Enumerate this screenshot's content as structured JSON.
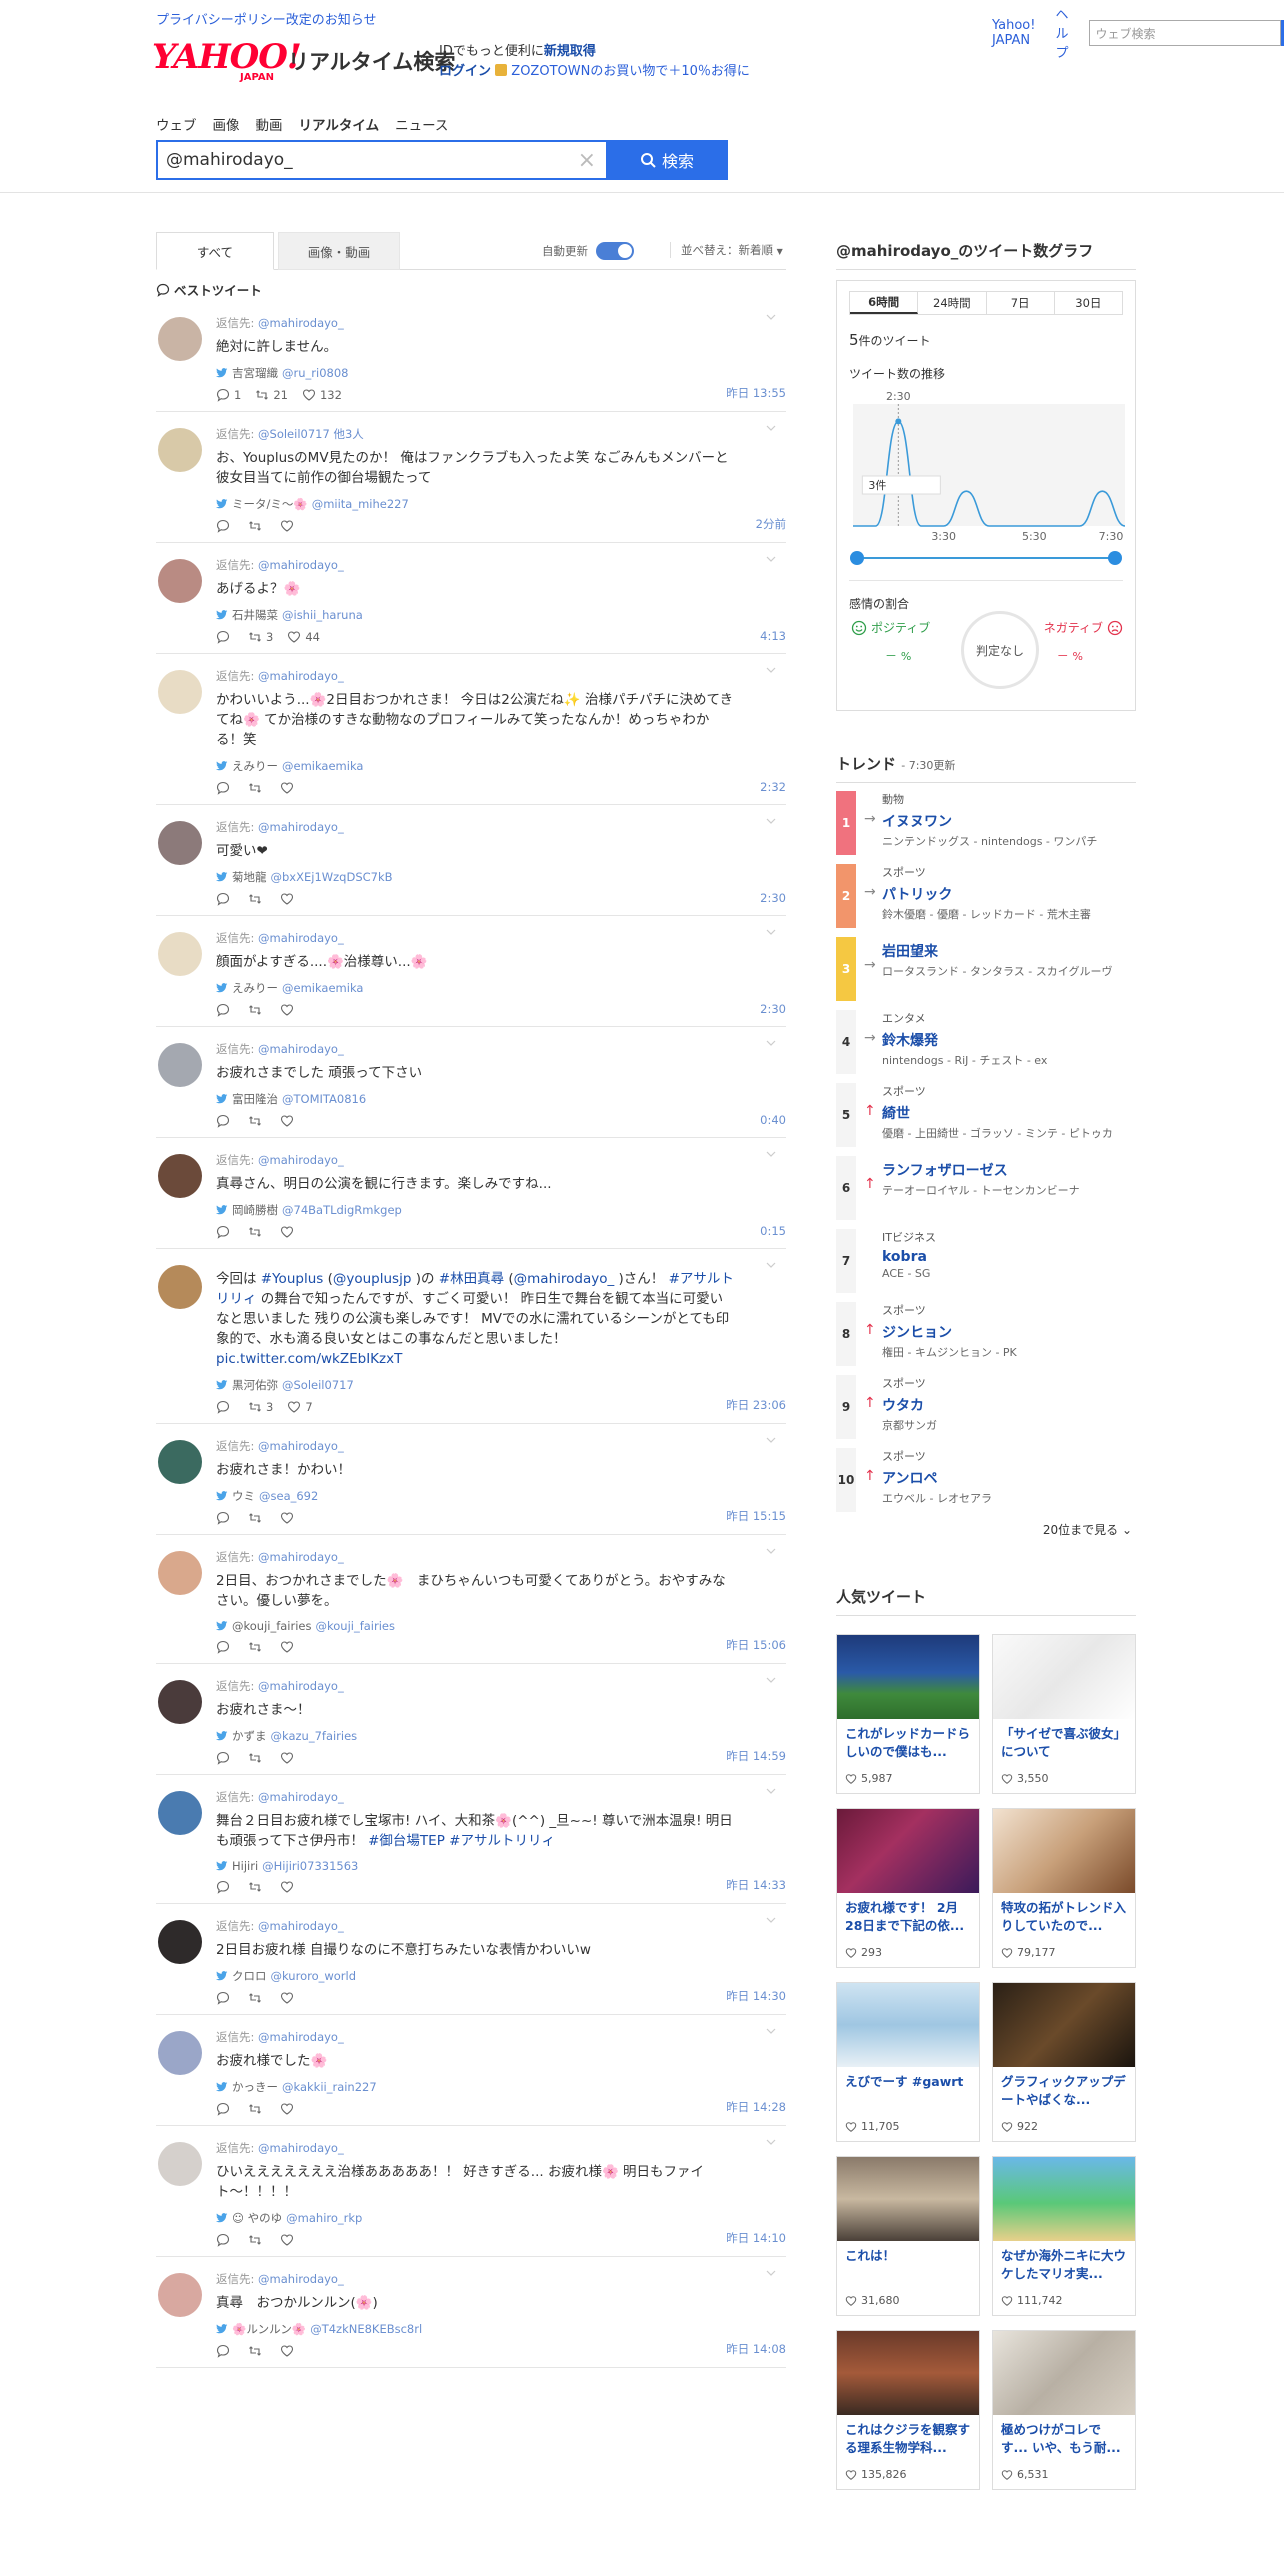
{
  "topbar": {
    "policy": "プライバシーポリシー改定のお知らせ",
    "yahoo_japan": "Yahoo! JAPAN",
    "help": "ヘルプ",
    "search_placeholder": "ウェブ検索"
  },
  "header": {
    "logo": "YAHOO!",
    "logo_sub": "JAPAN",
    "service": "リアルタイム検索",
    "id_text": "IDでもっと便利に",
    "register": "新規取得",
    "login": "ログイン",
    "zozo": "ZOZOTOWNのお買い物で＋10％お得に"
  },
  "nav": {
    "items": [
      "ウェブ",
      "画像",
      "動画",
      "リアルタイム",
      "ニュース"
    ]
  },
  "search": {
    "value": "@mahirodayo_",
    "button": "検索"
  },
  "tabs": {
    "all": "すべて",
    "media": "画像・動画",
    "auto_update": "自動更新",
    "sort": "並べ替え：新着順"
  },
  "best_label": "ベストツイート",
  "tweets": [
    {
      "reply": "@mahirodayo_",
      "text": "絶対に許しません。",
      "name": "吉宮瑠織",
      "screen": "@ru_ri0808",
      "reply_count": "1",
      "rt": "21",
      "fav": "132",
      "time": "昨日 13:55"
    },
    {
      "reply": "@Soleil0717 他3人",
      "text": "お、YouplusのMV見たのか！ 俺はファンクラブも入ったよ笑 なごみんもメンバーと彼女目当てに前作の御台場観たって",
      "name": "ミータ/ミ〜🌸",
      "screen": "@miita_mihe227",
      "reply_count": "",
      "rt": "",
      "fav": "",
      "time": "2分前"
    },
    {
      "reply": "@mahirodayo_",
      "text": "あげるよ？🌸",
      "name": "石井陽菜",
      "screen": "@ishii_haruna",
      "reply_count": "",
      "rt": "3",
      "fav": "44",
      "time": "4:13"
    },
    {
      "reply": "@mahirodayo_",
      "text": "かわいいよう...🌸2日目おつかれさま！ 今日は2公演だね✨ 治様パチパチに決めてきてね🌸 てか治様のすきな動物なのプロフィールみて笑ったなんか！めっちゃわかる！笑",
      "name": "えみりー",
      "screen": "@emikaemika",
      "reply_count": "",
      "rt": "",
      "fav": "",
      "time": "2:32"
    },
    {
      "reply": "@mahirodayo_",
      "text": "可愛い❤",
      "name": "菊地龍",
      "screen": "@bxXEj1WzqDSC7kB",
      "reply_count": "",
      "rt": "",
      "fav": "",
      "time": "2:30"
    },
    {
      "reply": "@mahirodayo_",
      "text": "顔面がよすぎる....🌸治様尊い...🌸",
      "name": "えみりー",
      "screen": "@emikaemika",
      "reply_count": "",
      "rt": "",
      "fav": "",
      "time": "2:30"
    },
    {
      "reply": "@mahirodayo_",
      "text": "お疲れさまでした 頑張って下さい",
      "name": "富田隆治",
      "screen": "@TOMITA0816",
      "reply_count": "",
      "rt": "",
      "fav": "",
      "time": "0:40"
    },
    {
      "reply": "@mahirodayo_",
      "text": "真尋さん、明日の公演を観に行きます。楽しみですね...",
      "name": "岡崎勝樹",
      "screen": "@74BaTLdigRmkgep",
      "reply_count": "",
      "rt": "",
      "fav": "",
      "time": "0:15"
    },
    {
      "reply": "",
      "text": "今回は #Youplus (@youplusjp )の #林田真尋 (@mahirodayo_ )さん！ #アサルトリリィ の舞台で知ったんですが、すごく可愛い！ 昨日生で舞台を観て本当に可愛いなと思いました 残りの公演も楽しみです！ MVでの水に濡れているシーンがとても印象的で、水も滴る良い女とはこの事なんだと思いました！ pic.twitter.com/wkZEbIKzxT",
      "name": "黒河佑弥",
      "screen": "@Soleil0717",
      "reply_count": "",
      "rt": "3",
      "fav": "7",
      "time": "昨日 23:06"
    },
    {
      "reply": "@mahirodayo_",
      "text": "お疲れさま！かわい！",
      "name": "ウミ",
      "screen": "@sea_692",
      "reply_count": "",
      "rt": "",
      "fav": "",
      "time": "昨日 15:15"
    },
    {
      "reply": "@mahirodayo_",
      "text": "2日目、おつかれさまでした🌸　まひちゃんいつも可愛くてありがとう。おやすみなさい。優しい夢を。",
      "name": "@kouji_fairies",
      "screen": "@kouji_fairies",
      "reply_count": "",
      "rt": "",
      "fav": "",
      "time": "昨日 15:06"
    },
    {
      "reply": "@mahirodayo_",
      "text": "お疲れさま〜！",
      "name": "かずま",
      "screen": "@kazu_7fairies",
      "reply_count": "",
      "rt": "",
      "fav": "",
      "time": "昨日 14:59"
    },
    {
      "reply": "@mahirodayo_",
      "text": "舞台２日目お疲れ様でし宝塚市! ハイ、大和茶🌸(^^) _旦~~! 尊いで洲本温泉! 明日も頑張って下さ伊丹市！ #御台場TEP #アサルトリリィ",
      "name": "Hijiri",
      "screen": "@Hijiri07331563",
      "reply_count": "",
      "rt": "",
      "fav": "",
      "time": "昨日 14:33"
    },
    {
      "reply": "@mahirodayo_",
      "text": "2日目お疲れ様 自撮りなのに不意打ちみたいな表情かわいいw",
      "name": "クロロ",
      "screen": "@kuroro_world",
      "reply_count": "",
      "rt": "",
      "fav": "",
      "time": "昨日 14:30"
    },
    {
      "reply": "@mahirodayo_",
      "text": "お疲れ様でした🌸",
      "name": "かっきー",
      "screen": "@kakkii_rain227",
      "reply_count": "",
      "rt": "",
      "fav": "",
      "time": "昨日 14:28"
    },
    {
      "reply": "@mahirodayo_",
      "text": "ひいえええええええ治様あああああ！！ 好きすぎる... お疲れ様🌸 明日もファイト〜！！！！",
      "name": "☺ やのゆ",
      "screen": "@mahiro_rkp",
      "reply_count": "",
      "rt": "",
      "fav": "",
      "time": "昨日 14:10"
    },
    {
      "reply": "@mahirodayo_",
      "text": "真尋　おつかルンルン(🌸)",
      "name": "🌸ルンルン🌸",
      "screen": "@T4zkNE8KEBsc8rl",
      "reply_count": "",
      "rt": "",
      "fav": "",
      "time": "昨日 14:08"
    }
  ],
  "graph": {
    "title": "@mahirodayo_のツイート数グラフ",
    "tabs": [
      "6時間",
      "24時間",
      "7日",
      "30日"
    ],
    "count": "5",
    "count_unit": "件のツイート",
    "trend_label": "ツイート数の推移",
    "peak_time": "2:30",
    "tooltip": "3件",
    "x_ticks": [
      "3:30",
      "5:30",
      "7:30"
    ],
    "emotion_label": "感情の割合",
    "positive": "ポジティブ",
    "negative": "ネガティブ",
    "neutral": "判定なし",
    "pos_val": "－",
    "neg_val": "－",
    "pct": "%"
  },
  "chart_data": {
    "type": "line",
    "x": [
      "1:30",
      "2:00",
      "2:30",
      "3:00",
      "3:30",
      "4:00",
      "4:30",
      "5:00",
      "5:30",
      "6:00",
      "6:30",
      "7:00",
      "7:30"
    ],
    "values": [
      0,
      0,
      3,
      0,
      0,
      1,
      0,
      0,
      0,
      0,
      0,
      1,
      0
    ],
    "ylim": [
      0,
      3.5
    ]
  },
  "trend": {
    "title": "トレンド",
    "updated": "7:30更新",
    "more": "20位まで見る",
    "items": [
      {
        "rank": "1",
        "cat": "動物",
        "word": "イヌヌワン",
        "rel": "ニンテンドッグス - nintendogs - ワンパチ",
        "color": "#f0727e",
        "arrow": "→",
        "arrow_color": "#888"
      },
      {
        "rank": "2",
        "cat": "スポーツ",
        "word": "パトリック",
        "rel": "鈴木優磨 - 優磨 - レッドカード - 荒木主審",
        "color": "#f2956b",
        "arrow": "→",
        "arrow_color": "#888"
      },
      {
        "rank": "3",
        "cat": "",
        "word": "岩田望来",
        "rel": "ロータスランド - タンタラス - スカイグルーヴ",
        "color": "#f5c842",
        "arrow": "→",
        "arrow_color": "#888"
      },
      {
        "rank": "4",
        "cat": "エンタメ",
        "word": "鈴木爆発",
        "rel": "nintendogs - RiJ - チェスト - ex",
        "color": "",
        "arrow": "→",
        "arrow_color": "#888"
      },
      {
        "rank": "5",
        "cat": "スポーツ",
        "word": "綺世",
        "rel": "優磨 - 上田綺世 - ゴラッソ - ミンテ - ピトゥカ",
        "color": "",
        "arrow": "↑",
        "arrow_color": "#e3324c"
      },
      {
        "rank": "6",
        "cat": "",
        "word": "ランフォザローゼス",
        "rel": "テーオーロイヤル - トーセンカンビーナ",
        "color": "",
        "arrow": "↑",
        "arrow_color": "#e3324c"
      },
      {
        "rank": "7",
        "cat": "ITビジネス",
        "word": "kobra",
        "rel": "ACE - SG",
        "color": "",
        "arrow": "",
        "arrow_color": "#888"
      },
      {
        "rank": "8",
        "cat": "スポーツ",
        "word": "ジンヒョン",
        "rel": "権田 - キムジンヒョン - PK",
        "color": "",
        "arrow": "↑",
        "arrow_color": "#e3324c"
      },
      {
        "rank": "9",
        "cat": "スポーツ",
        "word": "ウタカ",
        "rel": "京都サンガ",
        "color": "",
        "arrow": "↑",
        "arrow_color": "#e3324c"
      },
      {
        "rank": "10",
        "cat": "スポーツ",
        "word": "アンロペ",
        "rel": "エウベル - レオセアラ",
        "color": "",
        "arrow": "↑",
        "arrow_color": "#e3324c"
      }
    ]
  },
  "popular": {
    "title": "人気ツイート",
    "items": [
      {
        "text": "これがレッドカードらしいので僕はも...",
        "likes": "5,987"
      },
      {
        "text": "「サイゼで喜ぶ彼女」について",
        "likes": "3,550"
      },
      {
        "text": "お疲れ様です！ 2月28日まで下記の依...",
        "likes": "293"
      },
      {
        "text": "特攻の拓がトレンド入りしていたので...",
        "likes": "79,177"
      },
      {
        "text": "えびでーす #gawrt",
        "likes": "11,705"
      },
      {
        "text": "グラフィックアップデートやばくな...",
        "likes": "922"
      },
      {
        "text": "これは！",
        "likes": "31,680"
      },
      {
        "text": "なぜか海外ニキに大ウケしたマリオ実...",
        "likes": "111,742"
      },
      {
        "text": "これはクジラを観察する理系生物学科...",
        "likes": "135,826"
      },
      {
        "text": "極めつけがコレです... いや、もう耐...",
        "likes": "6,531"
      }
    ]
  },
  "colors": {
    "accent": "#2b6ee8",
    "link": "#1b4ea9",
    "yahoo_red": "#ff0033",
    "positive": "#2f9e4a",
    "negative": "#e3324c"
  }
}
